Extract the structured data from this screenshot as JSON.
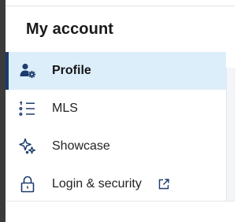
{
  "panel": {
    "title": "My account"
  },
  "menu": {
    "items": [
      {
        "label": "Profile",
        "icon": "user-gear-icon",
        "active": true
      },
      {
        "label": "MLS",
        "icon": "list-icon",
        "active": false
      },
      {
        "label": "Showcase",
        "icon": "sparkle-icon",
        "active": false
      },
      {
        "label": "Login & security",
        "icon": "lock-icon",
        "active": false,
        "external": true,
        "trailing_icon": "external-link-icon"
      }
    ]
  },
  "colors": {
    "active_background": "#ddeefb",
    "active_indicator": "#1d3c6e",
    "icon_color": "#1d3c6e",
    "text_color": "#222222"
  }
}
